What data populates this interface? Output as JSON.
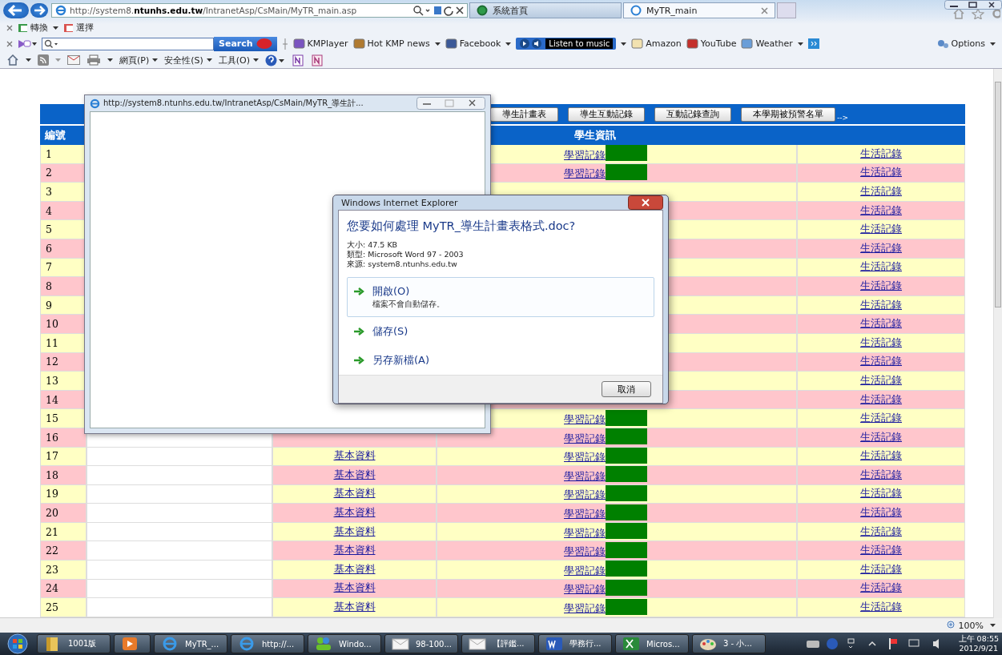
{
  "browser": {
    "address": "http://system8.**ntunhs.edu.tw**/IntranetAsp/CsMain/MyTR_main.asp",
    "tabs": [
      {
        "label": "系統首頁",
        "selected": false
      },
      {
        "label": "MyTR_main",
        "selected": true
      }
    ]
  },
  "command_bar": [
    "轉換",
    "選擇"
  ],
  "toolbar": {
    "search_button": "Search",
    "links": [
      {
        "label": "KMPlayer",
        "kind": "link",
        "dropdown": false
      },
      {
        "label": "Hot KMP news",
        "kind": "link",
        "dropdown": true
      },
      {
        "label": "Facebook",
        "kind": "link",
        "dropdown": true
      },
      {
        "label": "Listen to music",
        "kind": "player",
        "dropdown": true
      },
      {
        "label": "Amazon",
        "kind": "link",
        "dropdown": false
      },
      {
        "label": "YouTube",
        "kind": "link",
        "dropdown": false
      },
      {
        "label": "Weather",
        "kind": "link",
        "dropdown": true
      }
    ],
    "options": "Options"
  },
  "menu_bar": [
    "網頁(P)",
    "安全性(S)",
    "工具(O)"
  ],
  "popup": {
    "title": "http://system8.ntunhs.edu.tw/IntranetAsp/CsMain/MyTR_導生計..."
  },
  "page": {
    "nav_buttons": [
      "導生計畫表",
      "導生互動記錄",
      "互動記錄查詢",
      "本學期被預警名單"
    ],
    "nav_arrow": "-->",
    "header": {
      "number": "編號",
      "info": "學生資訊"
    },
    "rows": [
      {
        "number": "1",
        "learning": "學習記錄",
        "life": "生活記錄"
      },
      {
        "number": "2",
        "learning": "學習記錄",
        "life": "生活記錄"
      },
      {
        "number": "3",
        "life": "生活記錄"
      },
      {
        "number": "4",
        "life": "生活記錄"
      },
      {
        "number": "5",
        "life": "生活記錄"
      },
      {
        "number": "6",
        "life": "生活記錄"
      },
      {
        "number": "7",
        "life": "生活記錄"
      },
      {
        "number": "8",
        "life": "生活記錄"
      },
      {
        "number": "9",
        "life": "生活記錄"
      },
      {
        "number": "10",
        "life": "生活記錄"
      },
      {
        "number": "11",
        "life": "生活記錄"
      },
      {
        "number": "12",
        "life": "生活記錄"
      },
      {
        "number": "13",
        "life": "生活記錄"
      },
      {
        "number": "14",
        "life": "生活記錄"
      },
      {
        "number": "15",
        "learning": "學習記錄",
        "life": "生活記錄"
      },
      {
        "number": "16",
        "learning": "學習記錄",
        "life": "生活記錄"
      },
      {
        "number": "17",
        "basic": "基本資料",
        "learning": "學習記錄",
        "life": "生活記錄"
      },
      {
        "number": "18",
        "basic": "基本資料",
        "learning": "學習記錄",
        "life": "生活記錄"
      },
      {
        "number": "19",
        "basic": "基本資料",
        "learning": "學習記錄",
        "life": "生活記錄"
      },
      {
        "number": "20",
        "basic": "基本資料",
        "learning": "學習記錄",
        "life": "生活記錄"
      },
      {
        "number": "21",
        "basic": "基本資料",
        "learning": "學習記錄",
        "life": "生活記錄"
      },
      {
        "number": "22",
        "basic": "基本資料",
        "learning": "學習記錄",
        "life": "生活記錄"
      },
      {
        "number": "23",
        "basic": "基本資料",
        "learning": "學習記錄",
        "life": "生活記錄"
      },
      {
        "number": "24",
        "basic": "基本資料",
        "learning": "學習記錄",
        "life": "生活記錄"
      },
      {
        "number": "25",
        "basic": "基本資料",
        "learning": "學習記錄",
        "life": "生活記錄"
      }
    ]
  },
  "dialog": {
    "title": "Windows Internet Explorer",
    "question": "您要如何處理 MyTR_導生計畫表格式.doc?",
    "details": [
      "大小: 47.5 KB",
      "類型: Microsoft Word 97 - 2003",
      "來源: system8.ntunhs.edu.tw"
    ],
    "options": [
      {
        "label": "開啟(O)",
        "note": "檔案不會自動儲存。",
        "selected": true
      },
      {
        "label": "儲存(S)",
        "selected": false
      },
      {
        "label": "另存新檔(A)",
        "selected": false
      }
    ],
    "cancel": "取消"
  },
  "status_bar": {
    "zoom": "100%"
  },
  "taskbar": {
    "items": [
      {
        "kind": "folder",
        "label": "1001版"
      },
      {
        "kind": "media"
      },
      {
        "kind": "ie",
        "label": "MyTR_..."
      },
      {
        "kind": "ie",
        "label": "http://..."
      },
      {
        "kind": "messenger",
        "label": "Windo..."
      },
      {
        "kind": "mail",
        "label": "98-100..."
      },
      {
        "kind": "mail",
        "label": "【評鑑..."
      },
      {
        "kind": "word",
        "label": "學務行..."
      },
      {
        "kind": "excel",
        "label": "Micros..."
      },
      {
        "kind": "paint",
        "label": "3 - 小..."
      }
    ],
    "time": "上午 08:55",
    "date": "2012/9/21"
  }
}
